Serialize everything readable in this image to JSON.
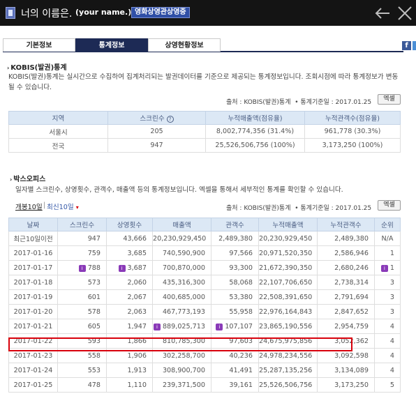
{
  "window": {
    "title": "너의 이름은.",
    "subtitle": "(your name.)",
    "badge": "영화상영관상영중"
  },
  "tabs": [
    "기본정보",
    "통계정보",
    "상영현황정보"
  ],
  "active_tab": "통계정보",
  "kobis": {
    "section_title": "KOBIS(발권)통계",
    "description": "KOBIS(발권)통계는 실시간으로 수집하여 집계처리되는 발권데이터를 기준으로 제공되는 통계정보입니다. 조회시점에 따라 통계정보가 변동될 수 있습니다.",
    "source": "출처 : KOBIS(발권)통계",
    "base_date": "통계기준일 : 2017.01.25",
    "excel_label": "엑셀",
    "columns": [
      "지역",
      "스크린수",
      "누적매출액(점유율)",
      "누적관객수(점유율)"
    ],
    "help_icon": "?",
    "rows": [
      [
        "서울시",
        "205",
        "8,002,774,356 (31.4%)",
        "961,778 (30.3%)"
      ],
      [
        "전국",
        "947",
        "25,526,506,756 (100%)",
        "3,173,250 (100%)"
      ]
    ]
  },
  "boxoffice": {
    "section_title": "박스오피스",
    "description": "일자별 스크린수, 상영횟수, 관객수, 매출액 등의 통계정보입니다. 엑셀을 통해서 세부적인 통계를 확인할 수 있습니다.",
    "subtab_first": "개봉10일",
    "subtab_second": "최신10일",
    "source": "출처 : KOBIS(발권)통계",
    "base_date": "통계기준일 : 2017.01.25",
    "excel_label": "엑셀",
    "columns": [
      "날짜",
      "스크린수",
      "상영횟수",
      "매출액",
      "관객수",
      "누적매출액",
      "누적관객수",
      "순위"
    ],
    "mark_label": "i",
    "rows": [
      {
        "date": "최근10일이전",
        "screens": "947",
        "shows": "43,666",
        "sales": "20,230,929,450",
        "audience": "2,489,380",
        "cum_sales": "20,230,929,450",
        "cum_audience": "2,489,380",
        "rank": "N/A"
      },
      {
        "date": "2017-01-16",
        "screens": "759",
        "shows": "3,685",
        "sales": "740,590,900",
        "audience": "97,566",
        "cum_sales": "20,971,520,350",
        "cum_audience": "2,586,946",
        "rank": "1"
      },
      {
        "date": "2017-01-17",
        "screens": "788",
        "shows": "3,687",
        "sales": "700,870,000",
        "audience": "93,300",
        "cum_sales": "21,672,390,350",
        "cum_audience": "2,680,246",
        "rank": "1"
      },
      {
        "date": "2017-01-18",
        "screens": "573",
        "shows": "2,060",
        "sales": "435,316,300",
        "audience": "58,068",
        "cum_sales": "22,107,706,650",
        "cum_audience": "2,738,314",
        "rank": "3"
      },
      {
        "date": "2017-01-19",
        "screens": "601",
        "shows": "2,067",
        "sales": "400,685,000",
        "audience": "53,380",
        "cum_sales": "22,508,391,650",
        "cum_audience": "2,791,694",
        "rank": "3"
      },
      {
        "date": "2017-01-20",
        "screens": "578",
        "shows": "2,063",
        "sales": "467,773,193",
        "audience": "55,958",
        "cum_sales": "22,976,164,843",
        "cum_audience": "2,847,652",
        "rank": "3"
      },
      {
        "date": "2017-01-21",
        "screens": "605",
        "shows": "1,947",
        "sales": "889,025,713",
        "audience": "107,107",
        "cum_sales": "23,865,190,556",
        "cum_audience": "2,954,759",
        "rank": "4"
      },
      {
        "date": "2017-01-22",
        "screens": "593",
        "shows": "1,866",
        "sales": "810,785,300",
        "audience": "97,603",
        "cum_sales": "24,675,975,856",
        "cum_audience": "3,052,362",
        "rank": "4"
      },
      {
        "date": "2017-01-23",
        "screens": "558",
        "shows": "1,906",
        "sales": "302,258,700",
        "audience": "40,236",
        "cum_sales": "24,978,234,556",
        "cum_audience": "3,092,598",
        "rank": "4"
      },
      {
        "date": "2017-01-24",
        "screens": "553",
        "shows": "1,913",
        "sales": "308,900,700",
        "audience": "41,491",
        "cum_sales": "25,287,135,256",
        "cum_audience": "3,134,089",
        "rank": "4"
      },
      {
        "date": "2017-01-25",
        "screens": "478",
        "shows": "1,110",
        "sales": "239,371,500",
        "audience": "39,161",
        "cum_sales": "25,526,506,756",
        "cum_audience": "3,173,250",
        "rank": "5"
      }
    ]
  },
  "colors": {
    "topbar": "#141414",
    "active_tab": "#1d2a55",
    "header_bg": "#dce8f5",
    "mark": "#8a3ab8",
    "highlight": "#d8000b"
  },
  "icons": [
    "film-icon",
    "back-arrow-icon",
    "close-icon",
    "facebook-icon",
    "help-icon",
    "mark-icon",
    "caret-down-icon"
  ]
}
